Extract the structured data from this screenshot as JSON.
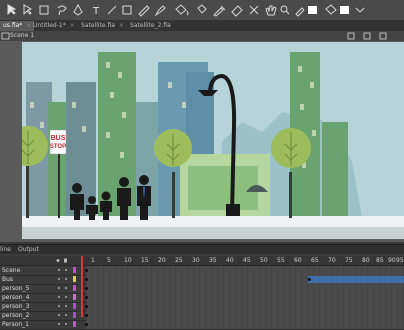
{
  "document_tabs": [
    {
      "label": "us.fla*",
      "active": true
    },
    {
      "label": "Untitled-1*",
      "active": false
    },
    {
      "label": "Satellite.fla",
      "active": false
    },
    {
      "label": "Satellite_2.fla",
      "active": false
    }
  ],
  "tab_close_glyph": "×",
  "scene": {
    "label": "Scene 1"
  },
  "stage": {
    "sign_line1": "BUS",
    "sign_line2": "STOP"
  },
  "timeline": {
    "tabs": [
      "line",
      "Output"
    ],
    "frame_numbers": [
      "1",
      "5",
      "10",
      "15",
      "20",
      "25",
      "30",
      "35",
      "40",
      "45",
      "50",
      "55",
      "60",
      "65",
      "70",
      "75",
      "80",
      "85",
      "90",
      "95"
    ],
    "layers": [
      {
        "name": "Scene",
        "color": "#c24fd0",
        "tween": false
      },
      {
        "name": "Bus",
        "color": "#e0d050",
        "tween": true
      },
      {
        "name": "person_5",
        "color": "#c24fd0",
        "tween": false
      },
      {
        "name": "person_4",
        "color": "#d06ad0",
        "tween": false
      },
      {
        "name": "person_3",
        "color": "#b24fd0",
        "tween": false
      },
      {
        "name": "person_2",
        "color": "#9b4fd0",
        "tween": false
      },
      {
        "name": "Person_1",
        "color": "#c24fd0",
        "tween": false
      }
    ]
  },
  "colors": {
    "accent": "#3f6ea8",
    "playhead": "#d9363e",
    "sky": "#b6d3d8",
    "ground": "#eef2f2"
  }
}
